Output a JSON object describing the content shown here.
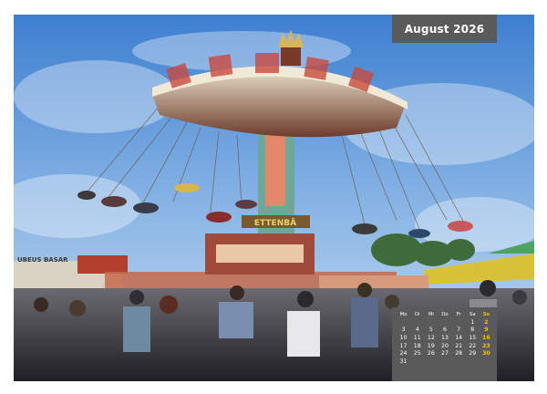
{
  "calendar": {
    "month_title": "August 2026",
    "weekdays": [
      "Mo",
      "Di",
      "Mi",
      "Do",
      "Fr",
      "Sa",
      "So"
    ],
    "weeks": [
      [
        "",
        "",
        "",
        "",
        "",
        "1",
        "2"
      ],
      [
        "3",
        "4",
        "5",
        "6",
        "7",
        "8",
        "9"
      ],
      [
        "10",
        "11",
        "12",
        "13",
        "14",
        "15",
        "16"
      ],
      [
        "17",
        "18",
        "19",
        "20",
        "21",
        "22",
        "23"
      ],
      [
        "24",
        "25",
        "26",
        "27",
        "28",
        "29",
        "30"
      ],
      [
        "31",
        "",
        "",
        "",
        "",
        "",
        ""
      ]
    ],
    "sunday_color": "#f5c300",
    "panel_color": "#5a5a5a"
  },
  "photo": {
    "subject": "chain swing carousel at a fairground, watercolor style",
    "sign_text": "ETTENBÄ",
    "stall_text": "UBEUS BASAR"
  },
  "binding": {
    "color": "#b9bcc4"
  }
}
